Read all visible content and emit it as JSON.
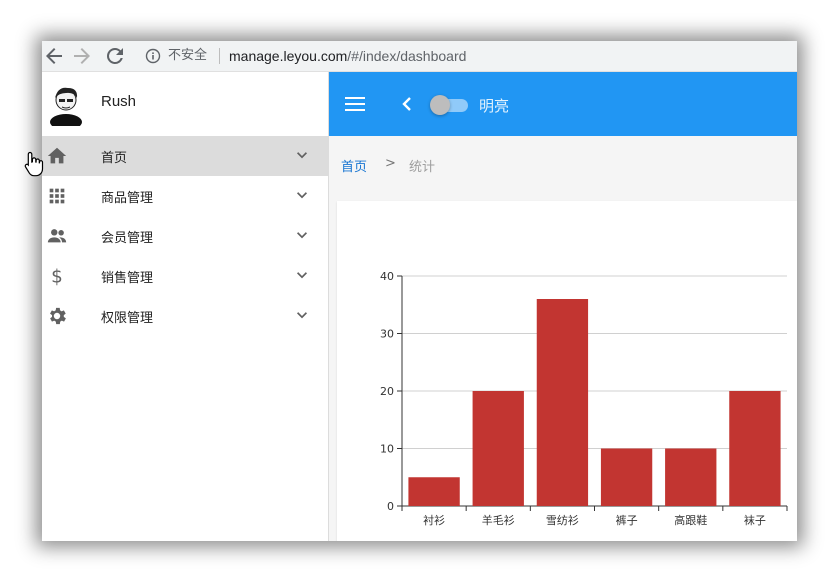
{
  "browser": {
    "security_label": "不安全",
    "url_host": "manage.leyou.com",
    "url_path": "/#/index/dashboard"
  },
  "sidebar": {
    "user_name": "Rush",
    "items": [
      {
        "label": "首页",
        "icon": "home-icon",
        "active": true
      },
      {
        "label": "商品管理",
        "icon": "apps-grid-icon",
        "active": false
      },
      {
        "label": "会员管理",
        "icon": "people-icon",
        "active": false
      },
      {
        "label": "销售管理",
        "icon": "dollar-icon",
        "active": false
      },
      {
        "label": "权限管理",
        "icon": "gear-icon",
        "active": false
      }
    ]
  },
  "appbar": {
    "theme_label": "明亮",
    "theme_toggle_on": false,
    "color": "#2196f3"
  },
  "breadcrumb": {
    "home": "首页",
    "separator": ">",
    "current": "统计"
  },
  "chart_data": {
    "type": "bar",
    "categories": [
      "衬衫",
      "羊毛衫",
      "雪纺衫",
      "裤子",
      "高跟鞋",
      "袜子"
    ],
    "values": [
      5,
      20,
      36,
      10,
      10,
      20
    ],
    "ylim": [
      0,
      40
    ],
    "yticks": [
      0,
      10,
      20,
      30,
      40
    ],
    "grid": true,
    "bar_color": "#c23531"
  }
}
